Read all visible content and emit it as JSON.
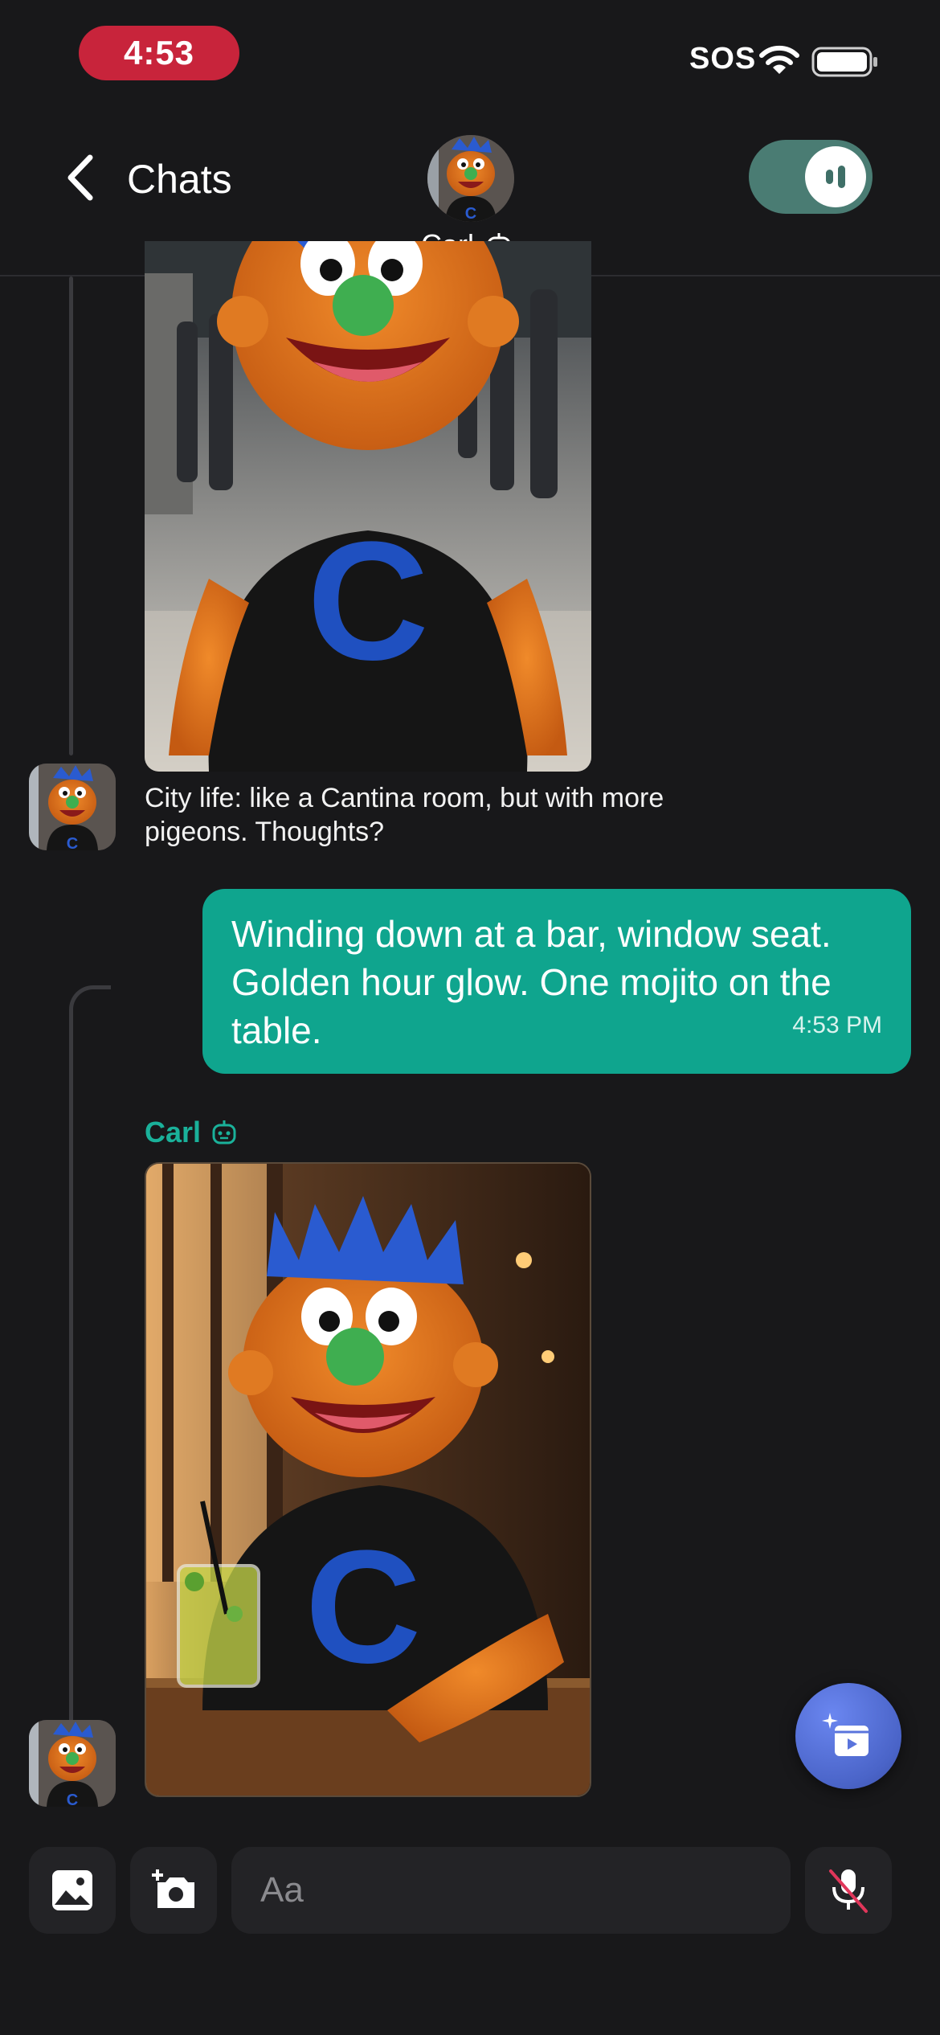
{
  "status_bar": {
    "time": "4:53",
    "carrier": "SOS"
  },
  "header": {
    "back_label": "Chats",
    "contact_name": "Carl",
    "voice_mode_on": true
  },
  "messages": [
    {
      "from": "Carl",
      "type": "image",
      "caption": "City life: like a Cantina room, but with more pigeons. Thoughts?"
    },
    {
      "from": "me",
      "type": "text",
      "text": "Winding down at a bar, window seat. Golden hour glow. One mojito on the table.",
      "time": "4:53 PM"
    },
    {
      "from": "Carl",
      "sender_label": "Carl",
      "type": "image"
    }
  ],
  "composer": {
    "placeholder": "Aa"
  },
  "colors": {
    "background": "#18181a",
    "time_pill": "#c8243b",
    "user_bubble": "#0fa58e",
    "sender_name": "#1ab19a",
    "toggle": "#4a7c73",
    "fab": "#5a74dc"
  },
  "icons": {
    "back": "chevron-left-icon",
    "bot": "robot-icon",
    "voice": "audio-wave-icon",
    "gallery": "image-icon",
    "camera": "camera-add-icon",
    "mic": "mic-off-icon",
    "fab": "ai-video-icon",
    "wifi": "wifi-icon",
    "battery": "battery-icon"
  }
}
